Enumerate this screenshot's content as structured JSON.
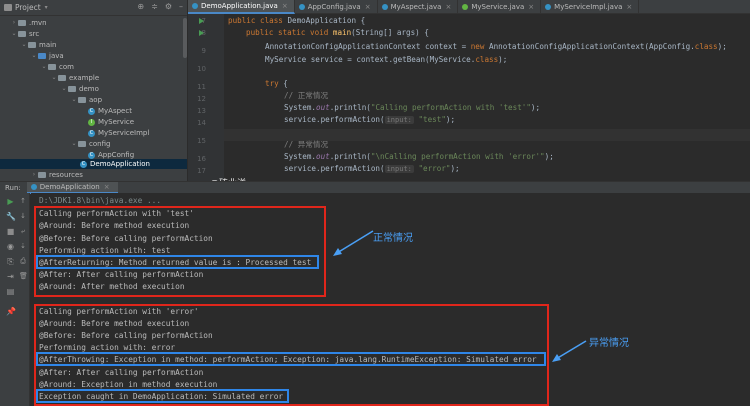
{
  "project_panel": {
    "title": "Project",
    "tree": [
      {
        "label": ".mvn",
        "type": "folder",
        "depth": 0,
        "expanded": false
      },
      {
        "label": "src",
        "type": "folder",
        "depth": 0,
        "expanded": true
      },
      {
        "label": "main",
        "type": "folder",
        "depth": 1,
        "expanded": true
      },
      {
        "label": "java",
        "type": "src-folder",
        "depth": 2,
        "expanded": true
      },
      {
        "label": "com",
        "type": "folder",
        "depth": 3,
        "expanded": true
      },
      {
        "label": "example",
        "type": "folder",
        "depth": 4,
        "expanded": true
      },
      {
        "label": "demo",
        "type": "folder",
        "depth": 5,
        "expanded": true
      },
      {
        "label": "aop",
        "type": "folder",
        "depth": 6,
        "expanded": true
      },
      {
        "label": "MyAspect",
        "type": "class",
        "depth": 7
      },
      {
        "label": "MyService",
        "type": "interface",
        "depth": 7
      },
      {
        "label": "MyServiceImpl",
        "type": "class",
        "depth": 7
      },
      {
        "label": "config",
        "type": "folder",
        "depth": 6,
        "expanded": true
      },
      {
        "label": "AppConfig",
        "type": "class",
        "depth": 7
      },
      {
        "label": "DemoApplication",
        "type": "class",
        "depth": 6,
        "selected": true
      },
      {
        "label": "resources",
        "type": "folder",
        "depth": 2,
        "expanded": false
      }
    ]
  },
  "editor": {
    "tabs": [
      {
        "label": "DemoApplication.java",
        "active": true
      },
      {
        "label": "AppConfig.java",
        "active": false
      },
      {
        "label": "MyAspect.java",
        "active": false
      },
      {
        "label": "MyService.java",
        "active": false
      },
      {
        "label": "MyServiceImpl.java",
        "active": false
      }
    ],
    "line_numbers": [
      "7",
      "8",
      "9",
      "10",
      "11",
      "12",
      "13",
      "14",
      "15",
      "16",
      "17"
    ],
    "code": {
      "l1": {
        "kw1": "public class ",
        "rest": "DemoApplication {"
      },
      "l2": {
        "kw1": "public static void ",
        "fn": "main",
        "rest": "(String[] args) {"
      },
      "l3": {
        "a": "AnnotationConfigApplicationContext context = ",
        "kw": "new ",
        "b": "AnnotationConfigApplicationContext(AppConfig.",
        "k2": "class",
        "c": ");"
      },
      "l4": {
        "a": "MyService service = context.getBean(MyService.",
        "k2": "class",
        "c": ");"
      },
      "l5": {
        "kw": "try ",
        "rest": "{"
      },
      "l6": {
        "cmt": "// 正常情况"
      },
      "l7": {
        "a": "System.",
        "f": "out",
        "b": ".println(",
        "s": "\"Calling performAction with 'test'\"",
        "c": ");"
      },
      "l8": {
        "a": "service.performAction(",
        "hint": "input:",
        "s": "\"test\"",
        "c": ");"
      },
      "l9": {
        "cmt": "// 异常情况"
      },
      "l10": {
        "a": "System.",
        "f": "out",
        "b": ".println(",
        "s": "\"\\nCalling performAction with 'error'\"",
        "c": ");"
      },
      "l11": {
        "a": "service.performAction(",
        "hint": "input:",
        "s": "\"error\"",
        "c": ");"
      }
    },
    "watermark": "@砖业洋__"
  },
  "run_panel": {
    "label": "Run:",
    "tab": "DemoApplication",
    "console_lines": [
      "D:\\JDK1.8\\bin\\java.exe ...",
      "Calling performAction with 'test'",
      "@Around: Before method execution",
      "@Before: Before calling performAction",
      "Performing action with: test",
      "@AfterReturning: Method returned value is : Processed test",
      "@After: After calling performAction",
      "@Around: After method execution",
      "",
      "Calling performAction with 'error'",
      "@Around: Before method execution",
      "@Before: Before calling performAction",
      "Performing action with: error",
      "@AfterThrowing: Exception in method: performAction; Exception: java.lang.RuntimeException: Simulated error",
      "@After: After calling performAction",
      "@Around: Exception in method execution",
      "Exception caught in DemoApplication: Simulated error"
    ],
    "annotations": {
      "normal": "正常情况",
      "abnormal": "异常情况"
    }
  },
  "colors": {
    "red_box": "#e0261b",
    "blue_box": "#2f86e8",
    "annotation": "#4a9ff5"
  }
}
